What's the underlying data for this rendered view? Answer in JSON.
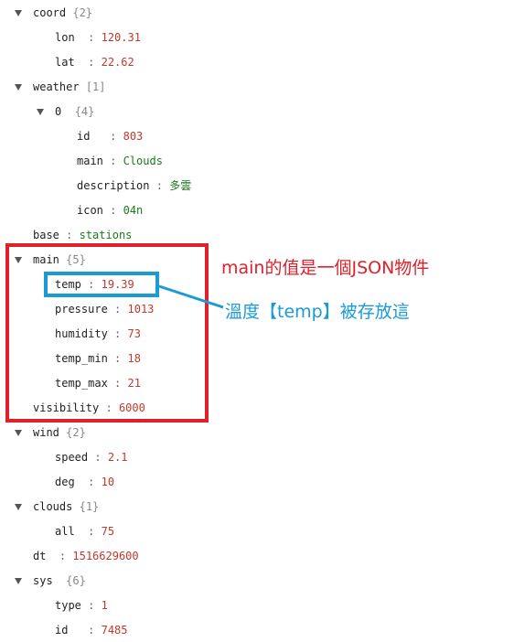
{
  "tree": {
    "coord": {
      "key": "coord",
      "meta": "{2}",
      "lon_key": "lon",
      "lon_val": "120.31",
      "lat_key": "lat",
      "lat_val": "22.62"
    },
    "weather": {
      "key": "weather",
      "meta": "[1]",
      "item0": {
        "key": "0",
        "meta": "{4}",
        "id_key": "id",
        "id_val": "803",
        "main_key": "main",
        "main_val": "Clouds",
        "desc_key": "description",
        "desc_val": "多雲",
        "icon_key": "icon",
        "icon_val": "04n"
      }
    },
    "base": {
      "key": "base",
      "val": "stations"
    },
    "main": {
      "key": "main",
      "meta": "{5}",
      "temp_key": "temp",
      "temp_val": "19.39",
      "pressure_key": "pressure",
      "pressure_val": "1013",
      "humidity_key": "humidity",
      "humidity_val": "73",
      "temp_min_key": "temp_min",
      "temp_min_val": "18",
      "temp_max_key": "temp_max",
      "temp_max_val": "21"
    },
    "visibility": {
      "key": "visibility",
      "val": "6000"
    },
    "wind": {
      "key": "wind",
      "meta": "{2}",
      "speed_key": "speed",
      "speed_val": "2.1",
      "deg_key": "deg",
      "deg_val": "10"
    },
    "clouds": {
      "key": "clouds",
      "meta": "{1}",
      "all_key": "all",
      "all_val": "75"
    },
    "dt": {
      "key": "dt",
      "val": "1516629600"
    },
    "sys": {
      "key": "sys",
      "meta": "{6}",
      "type_key": "type",
      "type_val": "1",
      "id_key": "id",
      "id_val": "7485"
    }
  },
  "annotations": {
    "main_note": "main的值是一個JSON物件",
    "temp_note": "溫度【temp】被存放這"
  },
  "colors": {
    "red_box": "#e0202a",
    "blue_box": "#1a9ad6",
    "number": "#c0392b",
    "string": "#1a7a1a"
  }
}
